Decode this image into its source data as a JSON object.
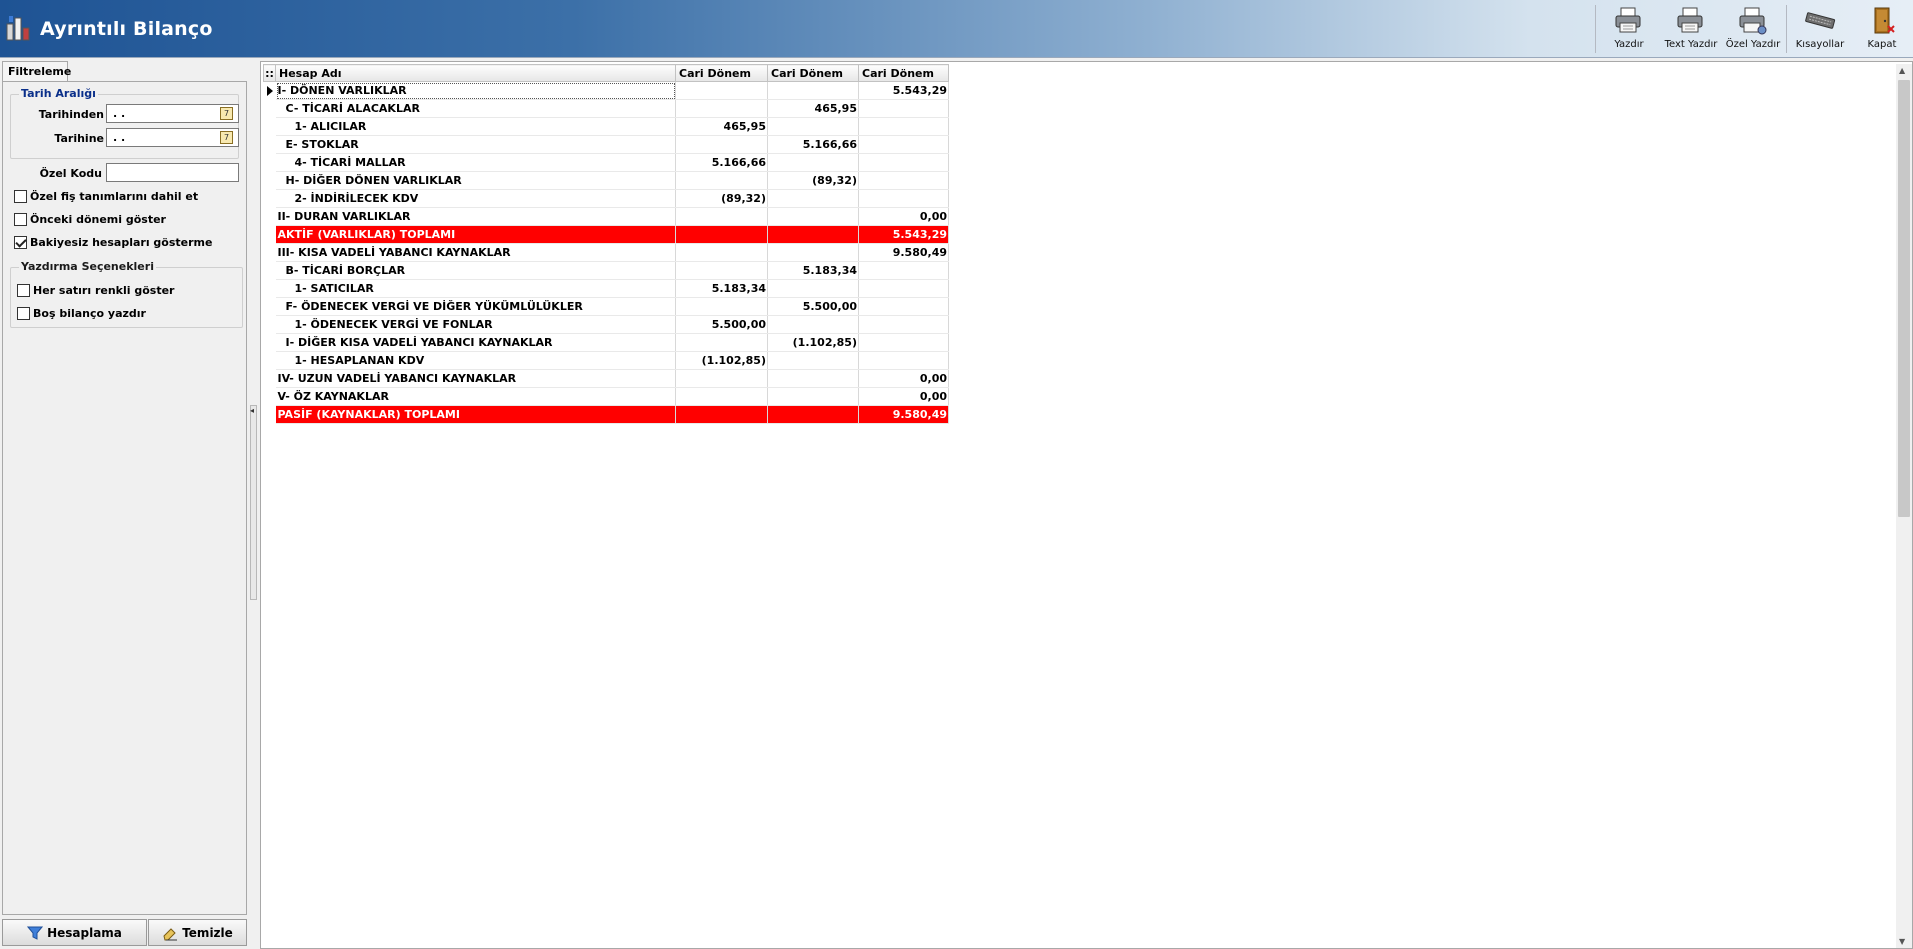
{
  "window": {
    "title": "Ayrıntılı Bilanço"
  },
  "toolbar": [
    {
      "label": "Yazdır",
      "icon": "printer-icon"
    },
    {
      "label": "Text Yazdır",
      "icon": "printer-icon"
    },
    {
      "label": "Özel Yazdır",
      "icon": "printer-icon"
    },
    {
      "label": "Kısayollar",
      "icon": "keyboard-icon"
    },
    {
      "label": "Kapat",
      "icon": "exit-door-icon"
    }
  ],
  "filter_panel": {
    "tab_label": "Filtreleme",
    "date_range_title": "Tarih Aralığı",
    "from_label": "Tarihinden",
    "from_value": " .  .",
    "to_label": "Tarihine",
    "to_value": " .  .",
    "special_code_label": "Özel Kodu",
    "special_code_value": "",
    "checkboxes": [
      {
        "label": "Özel fiş tanımlarını dahil et",
        "checked": false
      },
      {
        "label": "Önceki dönemi göster",
        "checked": false
      },
      {
        "label": "Bakiyesiz hesapları gösterme",
        "checked": true
      }
    ],
    "print_options_title": "Yazdırma Seçenekleri",
    "print_options": [
      {
        "label": "Her satırı renkli göster",
        "checked": false
      },
      {
        "label": "Boş bilanço yazdır",
        "checked": false
      }
    ],
    "calculate_label": "Hesaplama",
    "clear_label": "Temizle"
  },
  "grid": {
    "columns": [
      "Hesap Adı",
      "Cari Dönem",
      "Cari Dönem",
      "Cari Dönem"
    ],
    "rows": [
      {
        "name": "I-   DÖNEN VARLIKLAR",
        "c1": "",
        "c2": "",
        "c3": "5.543,29",
        "indent": 0,
        "current": true
      },
      {
        "name": "C- TİCARİ ALACAKLAR",
        "c1": "",
        "c2": "465,95",
        "c3": "",
        "indent": 1
      },
      {
        "name": "1- ALICILAR",
        "c1": "465,95",
        "c2": "",
        "c3": "",
        "indent": 2
      },
      {
        "name": "E- STOKLAR",
        "c1": "",
        "c2": "5.166,66",
        "c3": "",
        "indent": 1
      },
      {
        "name": "4- TİCARİ MALLAR",
        "c1": "5.166,66",
        "c2": "",
        "c3": "",
        "indent": 2
      },
      {
        "name": "H- DİĞER DÖNEN VARLIKLAR",
        "c1": "",
        "c2": "(89,32)",
        "c3": "",
        "indent": 1
      },
      {
        "name": "2- İNDİRİLECEK KDV",
        "c1": "(89,32)",
        "c2": "",
        "c3": "",
        "indent": 2
      },
      {
        "name": "II-  DURAN VARLIKLAR",
        "c1": "",
        "c2": "",
        "c3": "0,00",
        "indent": 0
      },
      {
        "name": "AKTİF (VARLIKLAR) TOPLAMI",
        "c1": "",
        "c2": "",
        "c3": "5.543,29",
        "indent": 0,
        "total": true
      },
      {
        "name": "III-   KISA VADELİ YABANCI KAYNAKLAR",
        "c1": "",
        "c2": "",
        "c3": "9.580,49",
        "indent": 0
      },
      {
        "name": "B- TİCARİ BORÇLAR",
        "c1": "",
        "c2": "5.183,34",
        "c3": "",
        "indent": 1
      },
      {
        "name": "1- SATICILAR",
        "c1": "5.183,34",
        "c2": "",
        "c3": "",
        "indent": 2
      },
      {
        "name": "F- ÖDENECEK VERGİ VE DİĞER YÜKÜMLÜLÜKLER",
        "c1": "",
        "c2": "5.500,00",
        "c3": "",
        "indent": 1
      },
      {
        "name": "1- ÖDENECEK VERGİ VE FONLAR",
        "c1": "5.500,00",
        "c2": "",
        "c3": "",
        "indent": 2
      },
      {
        "name": "I- DİĞER KISA VADELİ YABANCI KAYNAKLAR",
        "c1": "",
        "c2": "(1.102,85)",
        "c3": "",
        "indent": 1
      },
      {
        "name": "1- HESAPLANAN KDV",
        "c1": "(1.102,85)",
        "c2": "",
        "c3": "",
        "indent": 2
      },
      {
        "name": "IV-  UZUN VADELİ YABANCI KAYNAKLAR",
        "c1": "",
        "c2": "",
        "c3": "0,00",
        "indent": 0
      },
      {
        "name": "V- ÖZ KAYNAKLAR",
        "c1": "",
        "c2": "",
        "c3": "0,00",
        "indent": 0
      },
      {
        "name": "PASİF (KAYNAKLAR) TOPLAMI",
        "c1": "",
        "c2": "",
        "c3": "9.580,49",
        "indent": 0,
        "total": true
      }
    ]
  },
  "colors": {
    "total_row": "#ff0000",
    "title_gradient_start": "#1e5394"
  }
}
